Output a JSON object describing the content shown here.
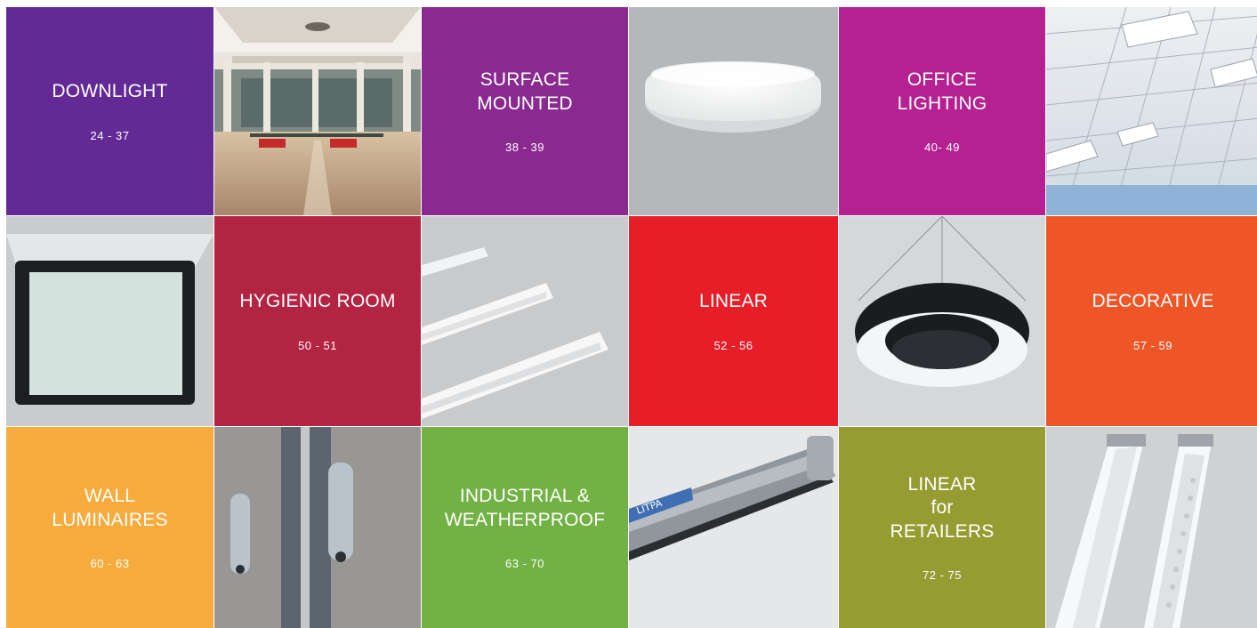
{
  "categories": [
    {
      "title": "DOWNLIGHT",
      "pages": "24 - 37",
      "color": "#632a96"
    },
    {
      "title": "SURFACE\nMOUNTED",
      "pages": "38 - 39",
      "color": "#8a2a91"
    },
    {
      "title": "OFFICE\nLIGHTING",
      "pages": "40- 49",
      "color": "#b52190"
    },
    {
      "title": "HYGIENIC ROOM",
      "pages": "50 - 51",
      "color": "#b32342"
    },
    {
      "title": "LINEAR",
      "pages": "52 - 56",
      "color": "#e71d27"
    },
    {
      "title": "DECORATIVE",
      "pages": "57 - 59",
      "color": "#ef5627"
    },
    {
      "title": "WALL\nLUMINAIRES",
      "pages": "60 - 63",
      "color": "#f8ab3d"
    },
    {
      "title": "INDUSTRIAL &\nWEATHERPROOF",
      "pages": "63 - 70",
      "color": "#72b144"
    },
    {
      "title": "LINEAR\nfor\nRETAILERS",
      "pages": "72 - 75",
      "color": "#969c31"
    }
  ],
  "photos": {
    "surface_lamp_brand": "LITPA"
  }
}
